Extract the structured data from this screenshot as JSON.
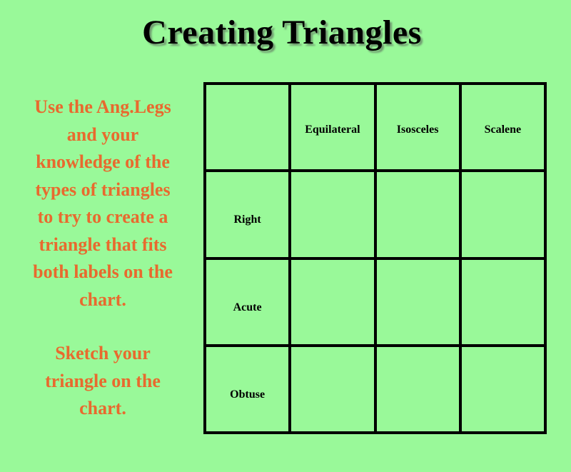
{
  "title": "Creating Triangles",
  "instructions": {
    "lines": [
      "Use the Ang.Legs",
      "and your",
      "knowledge of the",
      "types of triangles",
      "to try to create a",
      "triangle that fits",
      "both labels on the",
      "chart."
    ],
    "sketch_lines": [
      "Sketch your",
      "triangle on the",
      "chart."
    ]
  },
  "chart": {
    "corner": "",
    "columns": [
      "Equilateral",
      "Isosceles",
      "Scalene"
    ],
    "rows": [
      "Right",
      "Acute",
      "Obtuse"
    ],
    "cells": [
      [
        "",
        "",
        ""
      ],
      [
        "",
        "",
        ""
      ],
      [
        "",
        "",
        ""
      ]
    ]
  },
  "colors": {
    "background": "#99f999",
    "instruction_text": "#e86a2e",
    "grid_lines": "#000000"
  }
}
